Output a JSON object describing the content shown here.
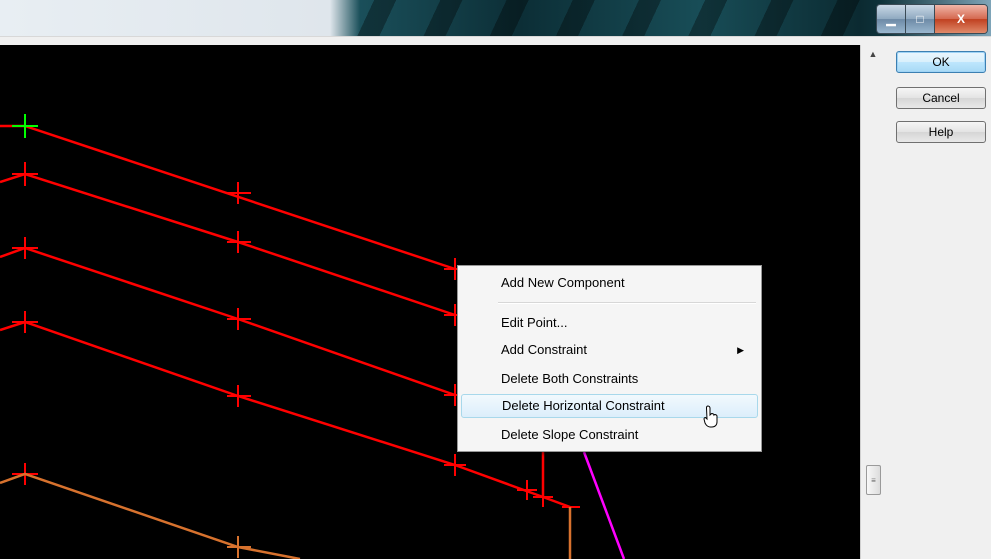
{
  "window": {
    "controls": {
      "minimize_icon": "minimize-icon",
      "maximize_icon": "maximize-icon",
      "close_icon": "close-icon",
      "minimize_glyph": "▁",
      "maximize_glyph": "□",
      "close_glyph": "X"
    }
  },
  "dialog_buttons": {
    "ok": "OK",
    "cancel": "Cancel",
    "help": "Help"
  },
  "scrollbar": {
    "up_arrow": "▲",
    "thumb_grip": "≡"
  },
  "context_menu": {
    "items": [
      {
        "label": "Add New Component"
      },
      {
        "label": "Edit Point..."
      },
      {
        "label": "Add Constraint",
        "submenu_arrow": "▶"
      },
      {
        "label": "Delete Both Constraints"
      },
      {
        "label": "Delete Horizontal Constraint",
        "highlighted": true
      },
      {
        "label": "Delete Slope Constraint"
      }
    ]
  },
  "canvas": {
    "background": "#000000",
    "line_colors": {
      "template": "#ff0000",
      "lower": "#e07830",
      "magenta": "#ff00ff",
      "origin_marker": "#00ff00"
    }
  }
}
